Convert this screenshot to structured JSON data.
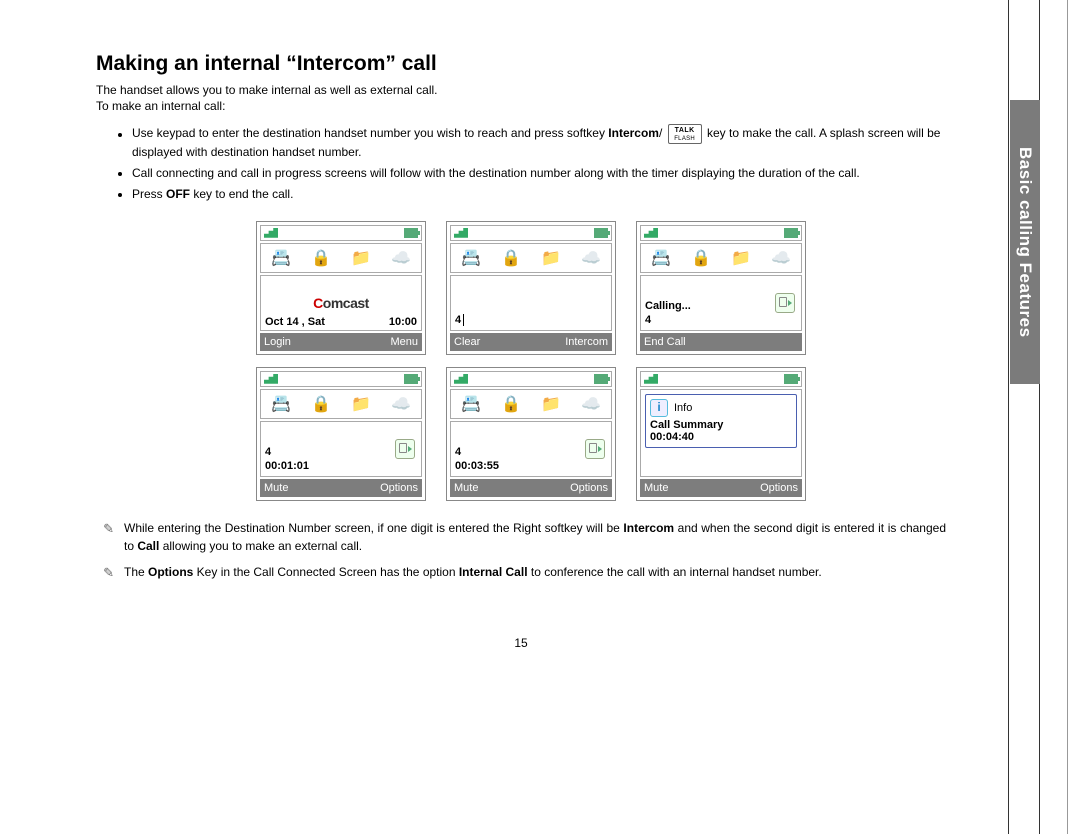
{
  "side_tab": "Basic calling Features",
  "page_number": "15",
  "title": "Making an internal “Intercom” call",
  "intro_line1": "The handset allows you to make internal as well as external call.",
  "intro_line2": "To make an internal call:",
  "bullets": [
    {
      "pre": "Use keypad to enter the destination handset number you wish to reach and press softkey ",
      "b1": "Intercom",
      "mid": "/ ",
      "key_top": "TALK",
      "key_bot": "FLASH",
      "post": " key to make the call. A splash screen will be displayed with destination handset number."
    },
    {
      "text": "Call connecting and call in progress screens will follow with the destination number along with the timer displaying the duration of the call."
    },
    {
      "pre": "Press ",
      "b1": "OFF",
      "post": " key to end the call."
    }
  ],
  "screens": {
    "s1": {
      "brand": "Comcast",
      "date": "Oct 14 , Sat",
      "time": "10:00",
      "left_sk": "Login",
      "right_sk": "Menu"
    },
    "s2": {
      "entry": "4",
      "left_sk": "Clear",
      "right_sk": "Intercom"
    },
    "s3": {
      "status": "Calling...",
      "num": "4",
      "left_sk": "End Call"
    },
    "s4": {
      "num": "4",
      "timer": "00:01:01",
      "left_sk": "Mute",
      "right_sk": "Options"
    },
    "s5": {
      "num": "4",
      "timer": "00:03:55",
      "left_sk": "Mute",
      "right_sk": "Options"
    },
    "s6": {
      "info_label": "Info",
      "summary": "Call Summary",
      "duration": "00:04:40",
      "left_sk": "Mute",
      "right_sk": "Options"
    }
  },
  "notes": [
    {
      "parts": [
        {
          "t": "While entering the Destination Number screen, if one digit is entered the Right softkey will be "
        },
        {
          "b": "Intercom"
        },
        {
          "t": " and when the second digit is entered it is changed to "
        },
        {
          "b": "Call"
        },
        {
          "t": " allowing you to make an external call."
        }
      ]
    },
    {
      "parts": [
        {
          "t": "The "
        },
        {
          "b": "Options"
        },
        {
          "t": " Key in the Call Connected Screen has the option "
        },
        {
          "b": "Internal Call"
        },
        {
          "t": " to conference the call with an internal handset number."
        }
      ]
    }
  ]
}
